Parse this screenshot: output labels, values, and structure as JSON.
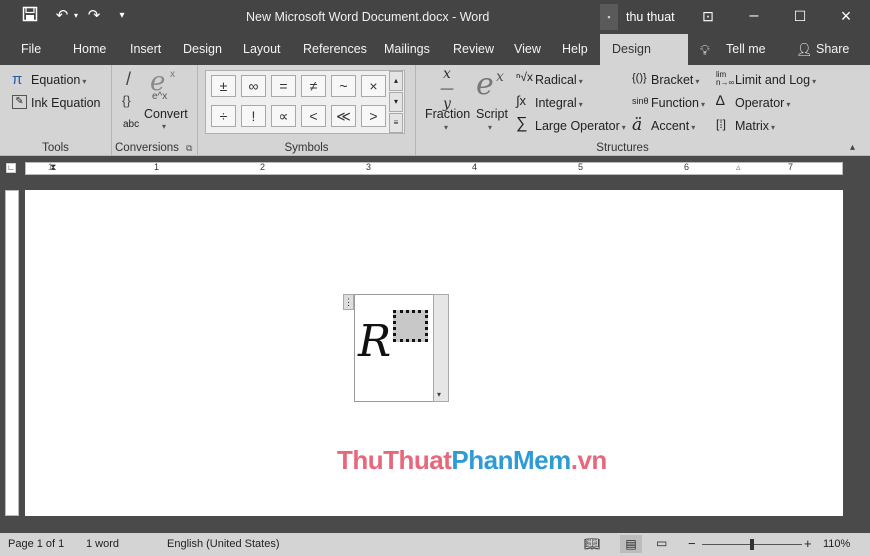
{
  "title_bar": {
    "title": "New Microsoft Word Document.docx  -  Word",
    "user": "thu thuat"
  },
  "menu": [
    "File",
    "Home",
    "Insert",
    "Design",
    "Layout",
    "References",
    "Mailings",
    "Review",
    "View",
    "Help",
    "Design"
  ],
  "tell_me": "Tell me",
  "share": "Share",
  "tools": {
    "equation": "Equation",
    "ink": "Ink Equation",
    "label": "Tools"
  },
  "conversions": {
    "convert": "Convert",
    "abc": "abc",
    "label": "Conversions"
  },
  "symbols": {
    "row1": [
      "±",
      "∞",
      "=",
      "≠",
      "~",
      "×"
    ],
    "row2": [
      "÷",
      "!",
      "∝",
      "<",
      "≪",
      ">"
    ],
    "label": "Symbols"
  },
  "structures": {
    "fraction": "Fraction",
    "script": "Script",
    "radical": "Radical",
    "integral": "Integral",
    "large_operator": "Large Operator",
    "bracket": "Bracket",
    "function": "Function",
    "accent": "Accent",
    "limit_log": "Limit and Log",
    "operator": "Operator",
    "matrix": "Matrix",
    "label": "Structures"
  },
  "ruler_numbers": [
    "1",
    "1",
    "2",
    "3",
    "4",
    "5",
    "6",
    "7"
  ],
  "equation": {
    "base": "R"
  },
  "watermark": {
    "part1": "ThuThuat",
    "part2": "PhanMem",
    "part3": ".vn",
    "color1": "#e8677c",
    "color2": "#2e9bd6",
    "color3": "#e8677c"
  },
  "status": {
    "page": "Page 1 of 1",
    "words": "1 word",
    "language": "English (United States)",
    "zoom": "110%"
  }
}
